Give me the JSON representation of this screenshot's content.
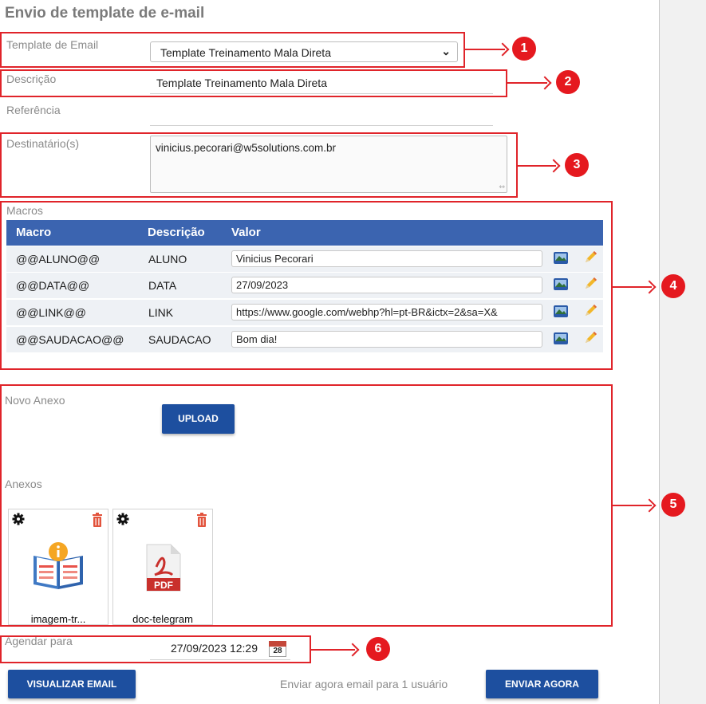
{
  "page": {
    "title": "Envio de template de e-mail",
    "template_label": "Template de Email",
    "template_value": "Template Treinamento Mala Direta",
    "descricao_label": "Descrição",
    "descricao_value": "Template Treinamento Mala Direta",
    "referencia_label": "Referência",
    "referencia_value": "",
    "destinatarios_label": "Destinatário(s)",
    "destinatarios_value": "vinicius.pecorari@w5solutions.com.br"
  },
  "macros": {
    "label": "Macros",
    "headers": [
      "Macro",
      "Descrição",
      "Valor"
    ],
    "rows": [
      {
        "macro": "@@ALUNO@@",
        "descricao": "ALUNO",
        "valor": "Vinicius Pecorari"
      },
      {
        "macro": "@@DATA@@",
        "descricao": "DATA",
        "valor": "27/09/2023"
      },
      {
        "macro": "@@LINK@@",
        "descricao": "LINK",
        "valor": "https://www.google.com/webhp?hl=pt-BR&ictx=2&sa=X&"
      },
      {
        "macro": "@@SAUDACAO@@",
        "descricao": "SAUDACAO",
        "valor": "Bom dia!"
      }
    ]
  },
  "anexos": {
    "novo_label": "Novo Anexo",
    "upload_label": "UPLOAD",
    "label": "Anexos",
    "files": [
      {
        "name": "imagem-tr...",
        "icon": "image-file-icon"
      },
      {
        "name": "doc-telegram",
        "icon": "pdf-file-icon"
      }
    ]
  },
  "agendar": {
    "label": "Agendar para",
    "value": "27/09/2023 12:29",
    "calendar_day": "28"
  },
  "footer": {
    "visualizar_label": "VISUALIZAR EMAIL",
    "info_text": "Enviar agora email para 1 usuário",
    "enviar_label": "ENVIAR AGORA"
  },
  "callouts": [
    "1",
    "2",
    "3",
    "4",
    "5",
    "6"
  ],
  "colors": {
    "annotation": "#e0242a",
    "primary": "#1d4f9f",
    "table_header": "#3b64b0"
  }
}
